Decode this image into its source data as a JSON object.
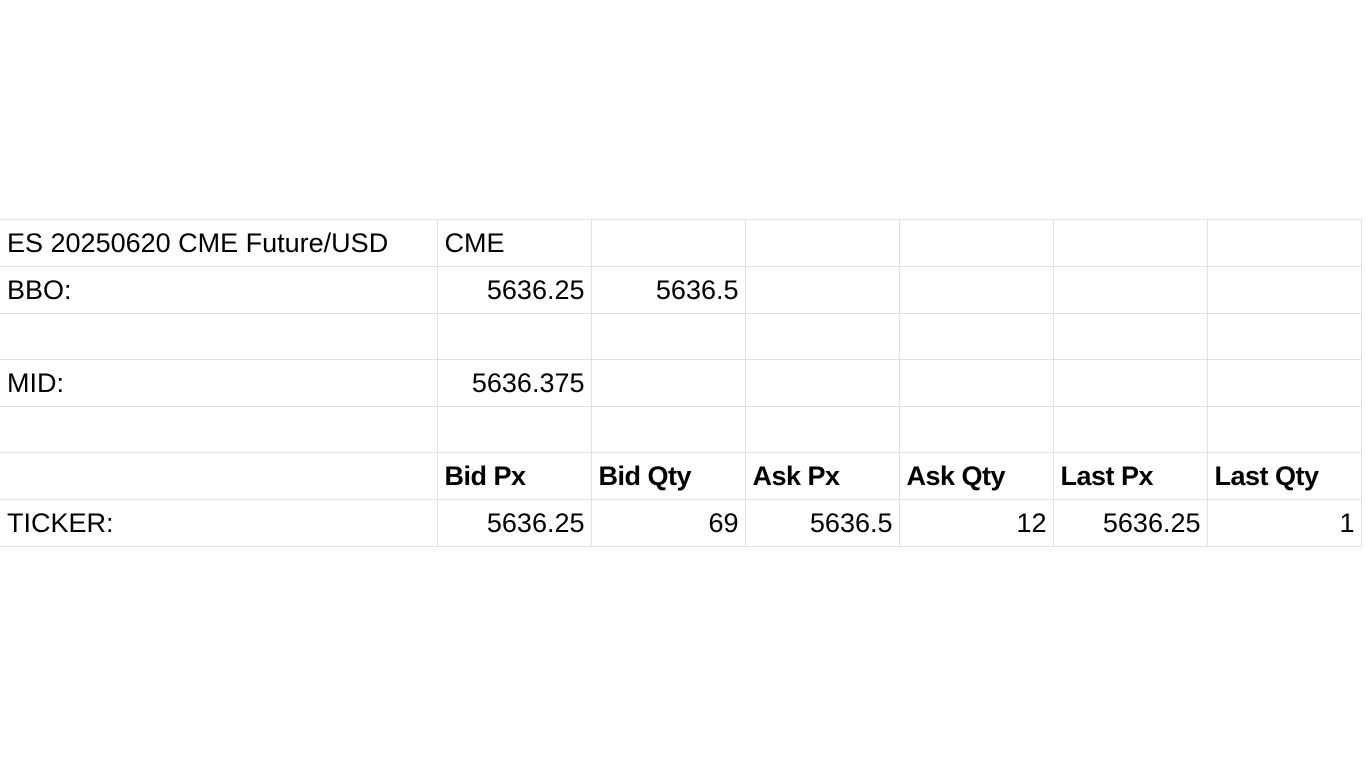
{
  "instrument": {
    "name": "ES 20250620 CME Future/USD",
    "exchange": "CME"
  },
  "bbo": {
    "label": "BBO:",
    "bid": "5636.25",
    "ask": "5636.5"
  },
  "mid": {
    "label": "MID:",
    "value": "5636.375"
  },
  "ticker": {
    "headers": [
      "Bid Px",
      "Bid Qty",
      "Ask Px",
      "Ask Qty",
      "Last Px",
      "Last Qty"
    ],
    "label": "TICKER:",
    "values": [
      "5636.25",
      "69",
      "5636.5",
      "12",
      "5636.25",
      "1"
    ]
  },
  "colors": {
    "gridline": "#e1e1e1",
    "background": "#ffffff",
    "text": "#000000"
  }
}
